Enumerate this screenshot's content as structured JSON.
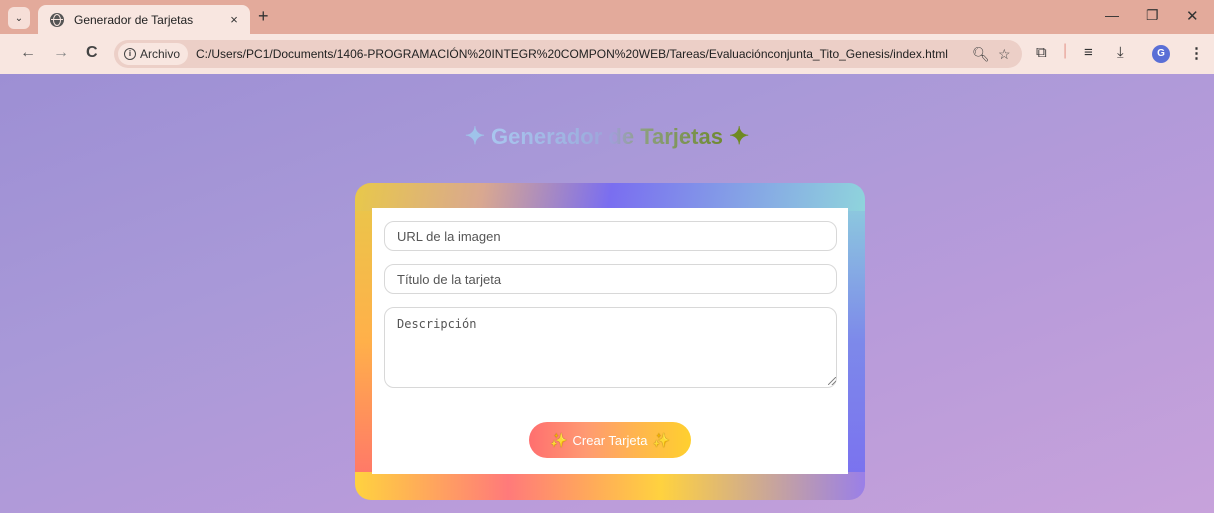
{
  "browser": {
    "tab_title": "Generador de Tarjetas",
    "tab_close": "×",
    "new_tab": "+",
    "tab_search": "⌄",
    "nav_back": "←",
    "nav_forward": "→",
    "nav_reload": "C",
    "security_chip": "Archivo",
    "url": "C:/Users/PC1/Documents/1406-PROGRAMACIÓN%20INTEGR%20COMPON%20WEB/Tareas/Evaluaciónconjunta_Tito_Genesis/index.html",
    "profile_initial": "G",
    "window": {
      "minimize": "—",
      "maximize": "❐",
      "close": "✕"
    }
  },
  "page": {
    "heading": "Generador de Tarjetas",
    "heading_icon_left": "✦",
    "heading_icon_right": "✦",
    "form": {
      "url_placeholder": "URL de la imagen",
      "title_placeholder": "Título de la tarjeta",
      "description_placeholder": "Descripción",
      "submit_label": "Crear Tarjeta",
      "submit_icon": "✨"
    }
  },
  "colors": {
    "page_background_start": "#9d8fd4",
    "page_background_end": "#c7a2db",
    "tab_strip": "#e3aa9b",
    "toolbar": "#f8e6e0",
    "button_gradient_start": "#ff6f6f",
    "button_gradient_end": "#ffd02f"
  }
}
